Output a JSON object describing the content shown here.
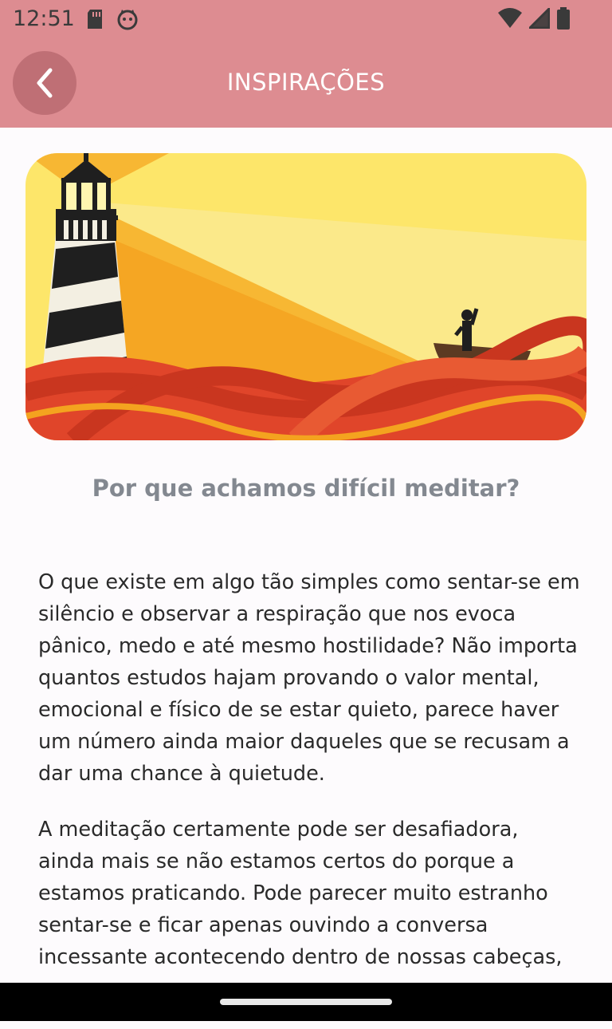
{
  "status_bar": {
    "time": "12:51",
    "left_icons": [
      "sd-card-icon",
      "cat-face-icon"
    ],
    "right_icons": [
      "wifi-icon",
      "signal-icon",
      "battery-icon"
    ]
  },
  "app_bar": {
    "title": "INSPIRAÇÕES",
    "back_icon": "chevron-left-icon"
  },
  "hero": {
    "description_icon": "lighthouse-illustration"
  },
  "article": {
    "title": "Por que achamos difícil meditar?",
    "paragraphs": [
      "O que existe em algo tão simples como sentar-se em silêncio e observar a respiração que nos evoca pânico, medo e até mesmo hostilidade? Não importa quantos estudos hajam provando o valor mental, emocional e físico de se estar quieto, parece haver um número ainda maior daqueles que se recusam a dar uma chance à quietude.",
      "A meditação certamente pode ser desafiadora, ainda mais se não estamos certos do porque a estamos praticando. Pode parecer muito estranho sentar-se e ficar apenas ouvindo a conversa incessante acontecendo dentro de nossas cabeças, e"
    ]
  },
  "colors": {
    "header": "#dd8c91",
    "back_button": "#bf6f75",
    "title_gray": "#838890"
  }
}
